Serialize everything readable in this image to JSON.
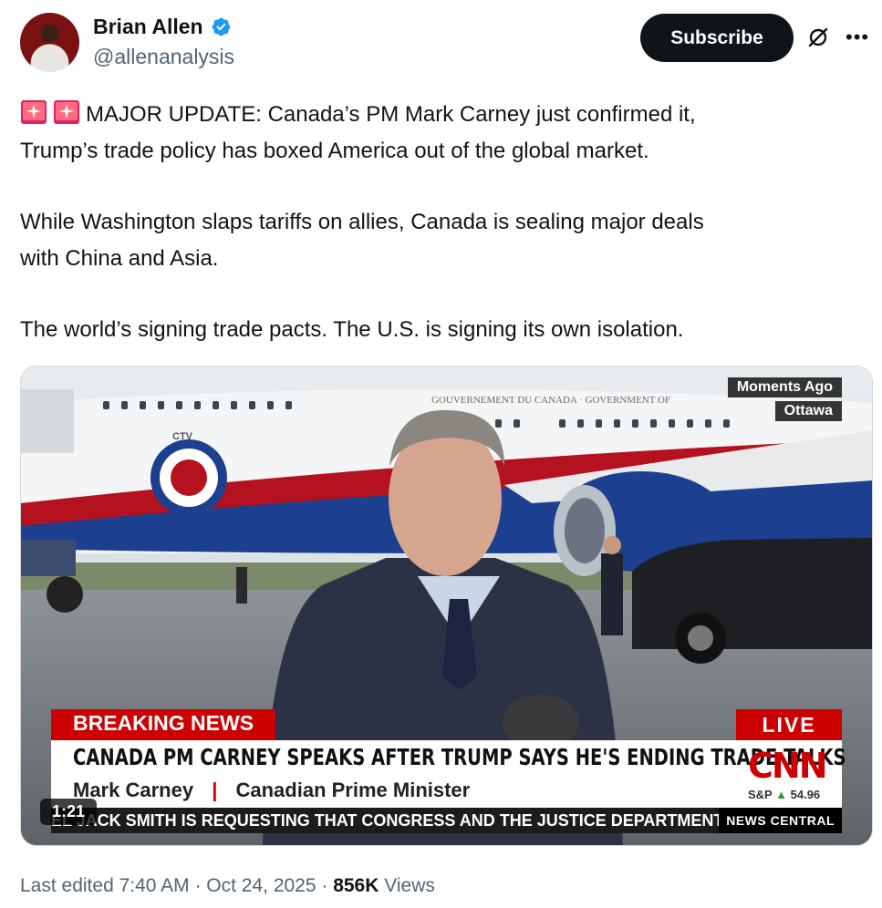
{
  "author": {
    "display_name": "Brian Allen",
    "handle": "@allenanalysis",
    "verified": true
  },
  "actions": {
    "subscribe_label": "Subscribe",
    "grok_icon": "grok-slash-icon",
    "more_icon": "more-horizontal-icon"
  },
  "tweet": {
    "line1": "MAJOR UPDATE: Canada’s PM Mark Carney just confirmed it,",
    "line2": "Trump’s trade policy has boxed America out of the global market.",
    "line3": "While Washington slaps tariffs on allies, Canada is sealing major deals",
    "line4": "with China and Asia.",
    "line5": "The world’s signing trade pacts. The U.S. is signing its own isolation.",
    "emoji": "rotating-light-emoji"
  },
  "video": {
    "tag_time": "Moments Ago",
    "tag_location": "Ottawa",
    "plane_lettering": "GOUVERNEMENT DU CANADA  ·  GOVERNMENT OF",
    "plane_small_label": "CTV",
    "breaking_label": "BREAKING NEWS",
    "live_label": "LIVE",
    "headline": "CANADA PM CARNEY SPEAKS AFTER TRUMP SAYS HE'S ENDING TRADE TALKS",
    "speaker_name": "Mark Carney",
    "speaker_sep": "|",
    "speaker_title": "Canadian Prime Minister",
    "network_logo": "CNN",
    "market_label": "S&P",
    "market_arrow": "▲",
    "market_value": "54.96",
    "ticker_text": "EL JACK SMITH IS REQUESTING THAT CONGRESS AND THE JUSTICE DEPARTMENT ALL",
    "ticker_brand": "NEWS CENTRAL",
    "duration": "1:21"
  },
  "meta": {
    "edited_label": "Last edited 7:40 AM · Oct 24, 2025 · ",
    "views_count": "856K",
    "views_label": " Views"
  },
  "colors": {
    "text": "#0f1419",
    "muted": "#536471",
    "verified": "#1d9bf0",
    "breaking_red": "#cc0000"
  }
}
